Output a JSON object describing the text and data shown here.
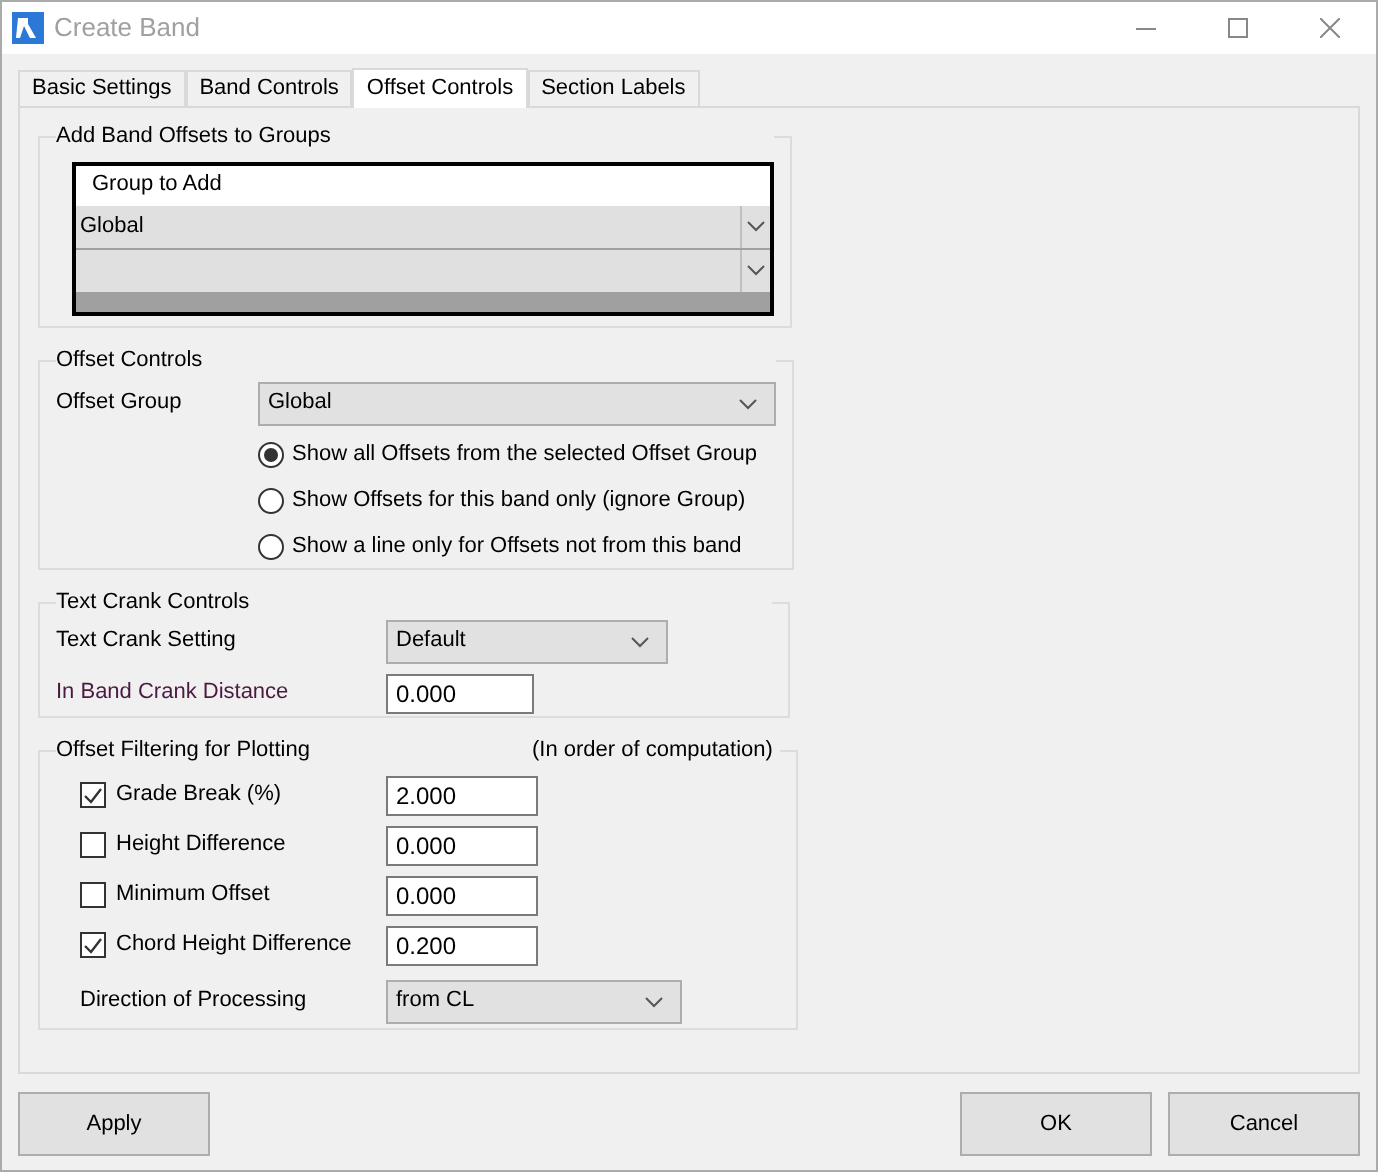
{
  "window": {
    "title": "Create Band"
  },
  "tabs": [
    {
      "label": "Basic Settings",
      "selected": false
    },
    {
      "label": "Band Controls",
      "selected": false
    },
    {
      "label": "Offset Controls",
      "selected": true
    },
    {
      "label": "Section Labels",
      "selected": false
    }
  ],
  "add_band_offsets": {
    "title": "Add Band Offsets to Groups",
    "grid": {
      "header": "Group to Add",
      "rows": [
        {
          "value": "Global"
        },
        {}
      ]
    }
  },
  "offset_controls": {
    "title": "Offset Controls",
    "offset_group": {
      "label": "Offset Group",
      "value": "Global"
    },
    "options": [
      {
        "label": "Show all Offsets from the selected Offset Group",
        "selected": true
      },
      {
        "label": "Show Offsets for this band only (ignore Group)",
        "selected": false
      },
      {
        "label": "Show a line only for Offsets not from this band",
        "selected": false
      }
    ]
  },
  "text_crank_controls": {
    "title": "Text Crank Controls",
    "setting": {
      "label": "Text Crank Setting",
      "value": "Default"
    },
    "distance": {
      "label": "In Band Crank Distance",
      "value": "0.000"
    }
  },
  "offset_filtering": {
    "title": "Offset Filtering for Plotting",
    "note": "(In order of computation)",
    "filters": [
      {
        "label": "Grade Break (%)",
        "checked": true,
        "value": "2.000"
      },
      {
        "label": "Height Difference",
        "checked": false,
        "value": "0.000"
      },
      {
        "label": "Minimum Offset",
        "checked": false,
        "value": "0.000"
      },
      {
        "label": "Chord Height Difference",
        "checked": true,
        "value": "0.200"
      }
    ],
    "direction": {
      "label": "Direction of Processing",
      "value": "from CL"
    }
  },
  "buttons": {
    "apply": "Apply",
    "ok": "OK",
    "cancel": "Cancel"
  }
}
